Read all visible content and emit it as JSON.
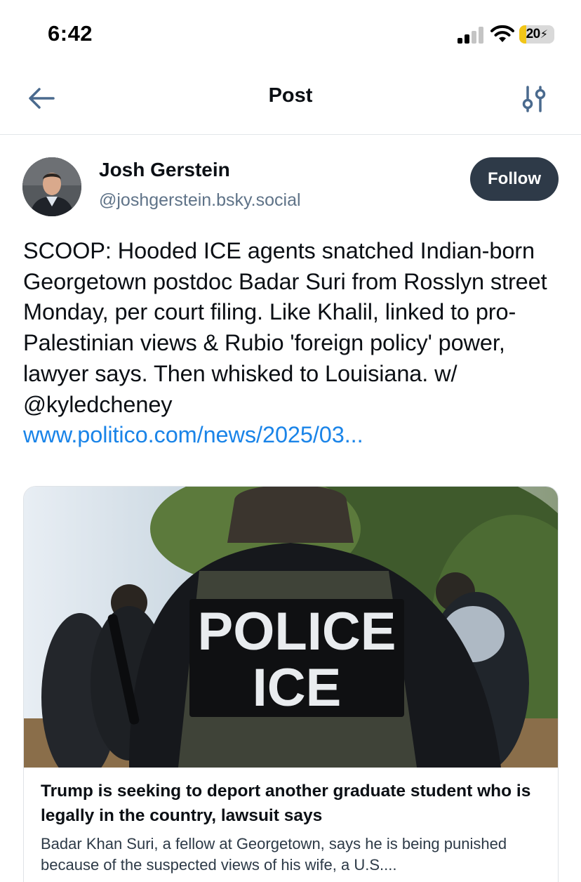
{
  "status_bar": {
    "time": "6:42",
    "battery_level": "20",
    "battery_fraction": 0.2,
    "signal_bars_active": 2,
    "icons": [
      "signal-icon",
      "wifi-icon",
      "battery-icon"
    ]
  },
  "header": {
    "title": "Post",
    "back_icon": "arrow-left-icon",
    "options_icon": "sliders-icon"
  },
  "post": {
    "author": {
      "name": "Josh Gerstein",
      "handle": "@joshgerstein.bsky.social",
      "follow_label": "Follow"
    },
    "text": "SCOOP: Hooded ICE agents snatched Indian-born Georgetown postdoc Badar Suri from Rosslyn street Monday, per court filing. Like Khalil, linked to pro-Palestinian views & Rubio 'foreign policy' power, lawyer says. Then whisked to Louisiana. w/ @kyledcheney",
    "link": "www.politico.com/news/2025/03...",
    "embed": {
      "image_text_line1": "POLICE",
      "image_text_line2": "ICE",
      "title": "Trump is seeking to deport another graduate student who is legally in the country, lawsuit says",
      "description": "Badar Khan Suri, a fellow at Georgetown, says he is being punished because of the suspected views of his wife, a U.S...."
    }
  },
  "colors": {
    "link": "#1a84e8",
    "follow_bg": "#2e3a48",
    "handle": "#5f7388",
    "icon": "#4a6a8e",
    "battery": "#f2c618"
  }
}
